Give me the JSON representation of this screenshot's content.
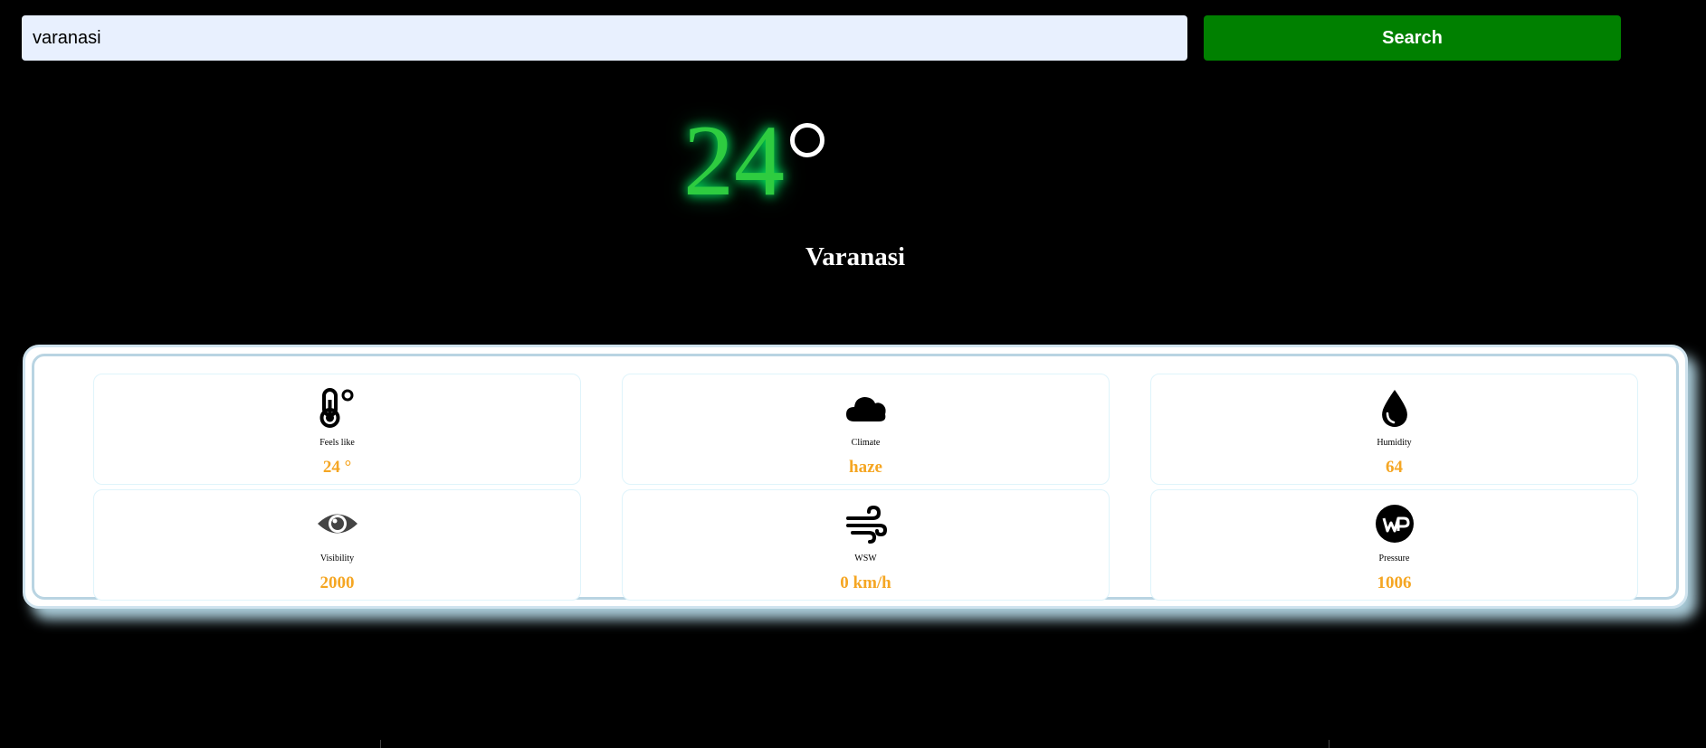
{
  "search": {
    "value": "varanasi",
    "button_label": "Search"
  },
  "current": {
    "temperature": "24",
    "city": "Varanasi"
  },
  "details": [
    {
      "icon": "thermometer-icon",
      "label": "Feels like",
      "value": "24 °"
    },
    {
      "icon": "cloud-icon",
      "label": "Climate",
      "value": "haze"
    },
    {
      "icon": "water-drop-icon",
      "label": "Humidity",
      "value": "64"
    },
    {
      "icon": "eye-icon",
      "label": "Visibility",
      "value": "2000"
    },
    {
      "icon": "wind-icon",
      "label": "WSW",
      "value": "0 km/h"
    },
    {
      "icon": "pressure-icon",
      "label": "Pressure",
      "value": "1006"
    }
  ],
  "colors": {
    "background": "#000000",
    "search_button": "#008000",
    "temperature": "#2ecc40",
    "detail_value": "#f5a623",
    "input_background": "#e8f0fe"
  }
}
